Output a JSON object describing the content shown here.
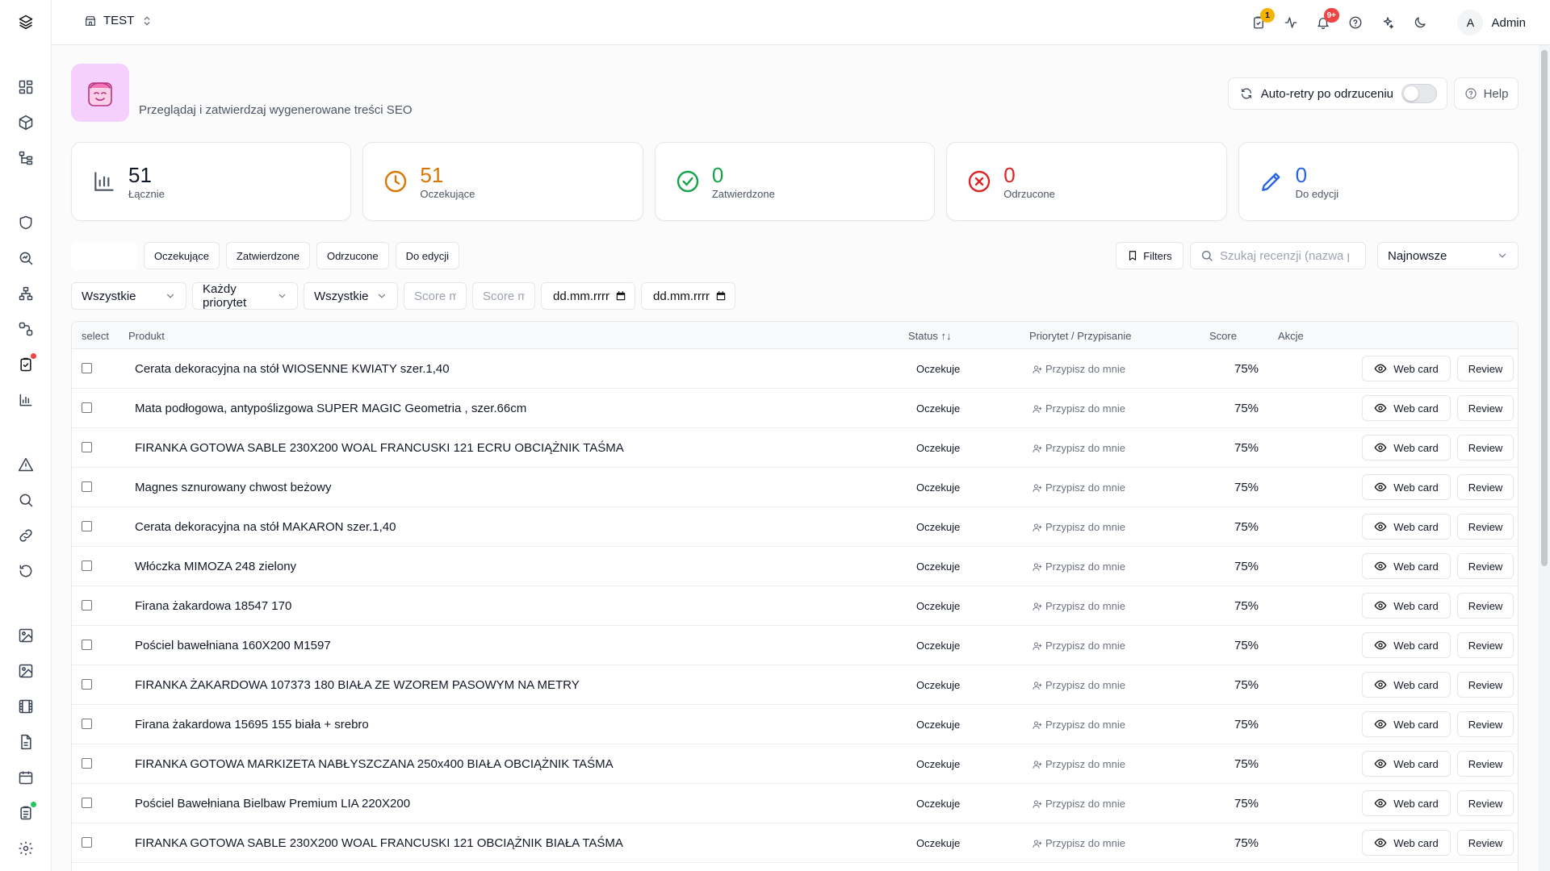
{
  "workspace": {
    "name": "TEST"
  },
  "topbar": {
    "tasks_badge": "1",
    "notifications_badge": "9+",
    "user_initial": "A",
    "user_name": "Admin"
  },
  "colors": {
    "accent_yellow": "#f5b301",
    "badge_red": "#ef4444",
    "pending": "#d97706",
    "approved": "#16a34a",
    "rejected": "#dc2626",
    "edit": "#2563eb",
    "sidebar_dot_red": "#ef4444",
    "sidebar_dot_green": "#22c55e"
  },
  "sidebar": {
    "items": [
      {
        "icon": "dashboard-icon"
      },
      {
        "icon": "package-icon"
      },
      {
        "icon": "tree-icon"
      },
      {
        "icon": "shield-icon"
      },
      {
        "icon": "search-analytics-icon"
      },
      {
        "icon": "network-icon"
      },
      {
        "icon": "workflow-icon"
      },
      {
        "icon": "review-clipboard-icon"
      },
      {
        "icon": "bar-chart-icon"
      },
      {
        "icon": "alert-icon"
      },
      {
        "icon": "search-icon"
      },
      {
        "icon": "link-icon"
      },
      {
        "icon": "history-icon"
      },
      {
        "icon": "image-icon"
      },
      {
        "icon": "gallery-icon"
      },
      {
        "icon": "film-icon"
      },
      {
        "icon": "document-icon"
      },
      {
        "icon": "calendar-icon"
      },
      {
        "icon": "checklist-icon"
      },
      {
        "icon": "settings-icon"
      }
    ]
  },
  "header": {
    "description": "Przeglądaj i zatwierdzaj wygenerowane treści SEO",
    "auto_retry_label": "Auto-retry po odrzuceniu",
    "auto_retry_enabled": false,
    "help_label": "Help"
  },
  "stats": [
    {
      "value": "51",
      "label": "Łącznie"
    },
    {
      "value": "51",
      "label": "Oczekujące"
    },
    {
      "value": "0",
      "label": "Zatwierdzone"
    },
    {
      "value": "0",
      "label": "Odrzucone"
    },
    {
      "value": "0",
      "label": "Do edycji"
    }
  ],
  "tabs": [
    "Oczekujące",
    "Zatwierdzone",
    "Odrzucone",
    "Do edycji"
  ],
  "toolbar": {
    "filters_label": "Filters",
    "search_placeholder": "Szukaj recenzji (nazwa produktu...)",
    "sort_value": "Najnowsze"
  },
  "filters": {
    "type_value": "Wszystkie",
    "priority_value": "Każdy priorytet",
    "assignee_value": "Wszystkie",
    "score_min_placeholder": "Score min",
    "score_max_placeholder": "Score max",
    "date_from": "dd.mm.rrrr",
    "date_to": "dd.mm.rrrr"
  },
  "table": {
    "headers": {
      "select": "select",
      "product": "Produkt",
      "status": "Status ↑↓",
      "priority": "Priorytet / Przypisanie",
      "score": "Score",
      "actions": "Akcje"
    },
    "assign_label": "Przypisz do mnie",
    "web_card_label": "Web card",
    "review_label": "Review",
    "rows": [
      {
        "product": "Cerata dekoracyjna na stół WIOSENNE KWIATY szer.1,40",
        "status": "Oczekuje",
        "score": "75%"
      },
      {
        "product": "Mata podłogowa, antypoślizgowa SUPER MAGIC Geometria , szer.66cm",
        "status": "Oczekuje",
        "score": "75%"
      },
      {
        "product": "FIRANKA GOTOWA SABLE 230X200 WOAL FRANCUSKI 121 ECRU OBCIĄŻNIK TAŚMA",
        "status": "Oczekuje",
        "score": "75%"
      },
      {
        "product": "Magnes sznurowany chwost beżowy",
        "status": "Oczekuje",
        "score": "75%"
      },
      {
        "product": "Cerata dekoracyjna na stół MAKARON szer.1,40",
        "status": "Oczekuje",
        "score": "75%"
      },
      {
        "product": "Włóczka MIMOZA 248 zielony",
        "status": "Oczekuje",
        "score": "75%"
      },
      {
        "product": "Firana żakardowa 18547 170",
        "status": "Oczekuje",
        "score": "75%"
      },
      {
        "product": "Pościel bawełniana 160X200 M1597",
        "status": "Oczekuje",
        "score": "75%"
      },
      {
        "product": "FIRANKA ŻAKARDOWA 107373 180 BIAŁA ZE WZOREM PASOWYM NA METRY",
        "status": "Oczekuje",
        "score": "75%"
      },
      {
        "product": "Firana żakardowa 15695 155 biała + srebro",
        "status": "Oczekuje",
        "score": "75%"
      },
      {
        "product": "FIRANKA GOTOWA MARKIZETA NABŁYSZCZANA 250x400 BIAŁA OBCIĄŻNIK TAŚMA",
        "status": "Oczekuje",
        "score": "75%"
      },
      {
        "product": "Pościel Bawełniana Bielbaw Premium LIA 220X200",
        "status": "Oczekuje",
        "score": "75%"
      },
      {
        "product": "FIRANKA GOTOWA SABLE 230X200 WOAL FRANCUSKI 121 OBCIĄŻNIK BIAŁA TAŚMA",
        "status": "Oczekuje",
        "score": "75%"
      }
    ]
  }
}
